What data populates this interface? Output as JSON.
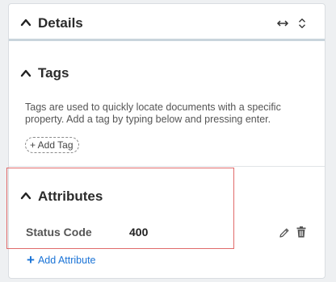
{
  "details": {
    "title": "Details"
  },
  "tags": {
    "title": "Tags",
    "description": "Tags are used to quickly locate documents with a specific property. Add a tag by typing below and pressing enter.",
    "add_tag_label": "+ Add Tag"
  },
  "attributes": {
    "title": "Attributes",
    "rows": [
      {
        "label": "Status Code",
        "value": "400"
      }
    ],
    "add_label": "Add Attribute"
  },
  "icons": {
    "collapse": "chevron-up-icon",
    "expand_horizontal": "arrows-horizontal-icon",
    "expand_vertical": "arrows-vertical-icon",
    "edit": "pencil-icon",
    "delete": "trash-icon",
    "add": "plus-icon"
  },
  "colors": {
    "accent": "#1a73d6",
    "highlight": "#e06b6b"
  }
}
